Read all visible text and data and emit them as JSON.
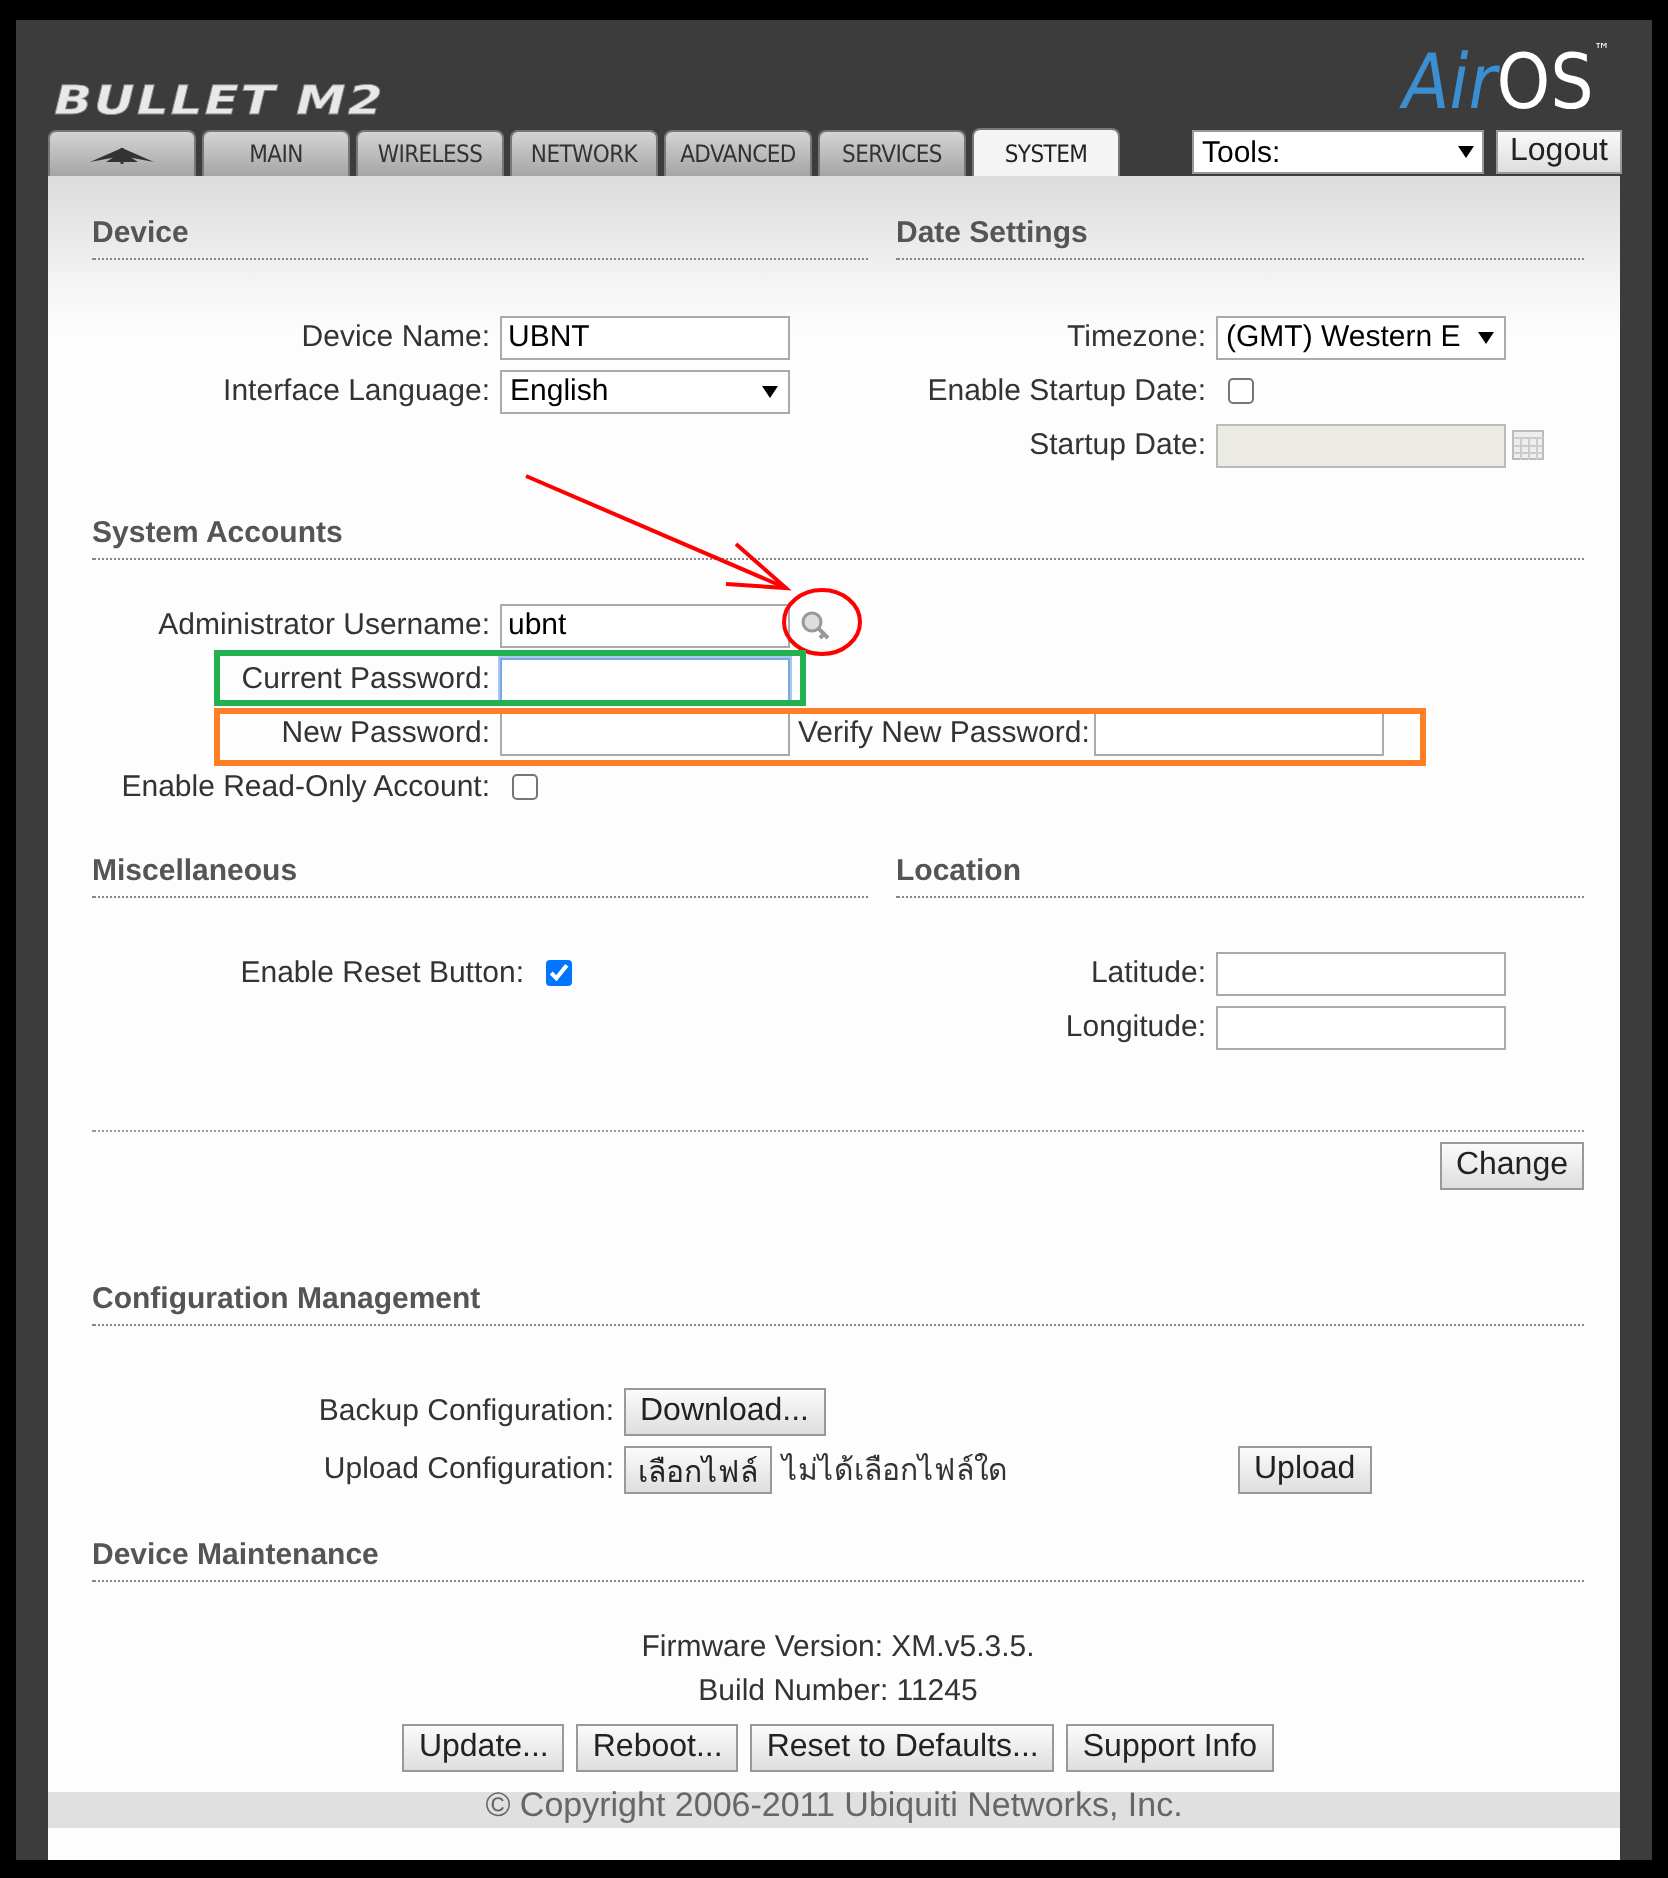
{
  "header": {
    "product": "BULLET M2",
    "brand_air": "Air",
    "brand_os": "OS",
    "brand_mark": "™"
  },
  "tabs": [
    {
      "kind": "logo",
      "selected": false
    },
    {
      "kind": "text",
      "label": "MAIN",
      "selected": false
    },
    {
      "kind": "text",
      "label": "WIRELESS",
      "selected": false
    },
    {
      "kind": "text",
      "label": "NETWORK",
      "selected": false
    },
    {
      "kind": "text",
      "label": "ADVANCED",
      "selected": false
    },
    {
      "kind": "text",
      "label": "SERVICES",
      "selected": false
    },
    {
      "kind": "text",
      "label": "SYSTEM",
      "selected": true
    }
  ],
  "tools_select": {
    "value": "Tools:"
  },
  "logout_button": "Logout",
  "device": {
    "title": "Device",
    "fields": [
      {
        "kind": "text",
        "label": "Device Name:",
        "value": "UBNT"
      },
      {
        "kind": "select",
        "label": "Interface Language:",
        "value": "English"
      }
    ]
  },
  "date_settings": {
    "title": "Date Settings",
    "fields": [
      {
        "kind": "select",
        "label": "Timezone:",
        "value": "(GMT) Western E"
      },
      {
        "kind": "checkbox",
        "label": "Enable Startup Date:",
        "checked": false
      },
      {
        "kind": "date",
        "label": "Startup Date:",
        "disabled": true
      }
    ]
  },
  "system_accounts": {
    "title": "System Accounts",
    "fields": [
      {
        "kind": "text_key",
        "label": "Administrator Username:",
        "value": "ubnt"
      },
      {
        "kind": "password",
        "label": "Current Password:",
        "focused": true
      },
      {
        "kind": "password_pair",
        "label": "New Password:",
        "label_2": "Verify New Password:"
      },
      {
        "kind": "checkbox",
        "label": "Enable Read-Only Account:",
        "checked": false
      }
    ]
  },
  "miscellaneous": {
    "title": "Miscellaneous",
    "fields": [
      {
        "kind": "checkbox",
        "label": "Enable Reset Button:",
        "checked": true
      }
    ]
  },
  "location": {
    "title": "Location",
    "fields": [
      {
        "kind": "text",
        "label": "Latitude:"
      },
      {
        "kind": "text",
        "label": "Longitude:"
      }
    ]
  },
  "change_button": "Change",
  "configuration_management": {
    "title": "Configuration Management",
    "backup": {
      "label": "Backup Configuration:",
      "button": "Download..."
    },
    "upload": {
      "label": "Upload Configuration:",
      "file_button": "เลือกไฟล์",
      "file_status": "ไม่ได้เลือกไฟล์ใด",
      "button": "Upload"
    }
  },
  "device_maintenance": {
    "title": "Device Maintenance",
    "info": [
      {
        "label": "Firmware Version:",
        "value": "XM.v5.3.5."
      },
      {
        "label": "Build Number:",
        "value": "11245"
      }
    ],
    "buttons": [
      "Update...",
      "Reboot...",
      "Reset to Defaults...",
      "Support Info"
    ]
  },
  "footer": {
    "copyright": "© Copyright 2006-2011 Ubiquiti Networks, Inc."
  },
  "annotations": [
    {
      "kind": "arrow",
      "color": "#ff0000"
    },
    {
      "kind": "circle",
      "color": "#ff0000"
    },
    {
      "kind": "box",
      "color": "#22b14c"
    },
    {
      "kind": "box",
      "color": "#ff7f27"
    }
  ]
}
